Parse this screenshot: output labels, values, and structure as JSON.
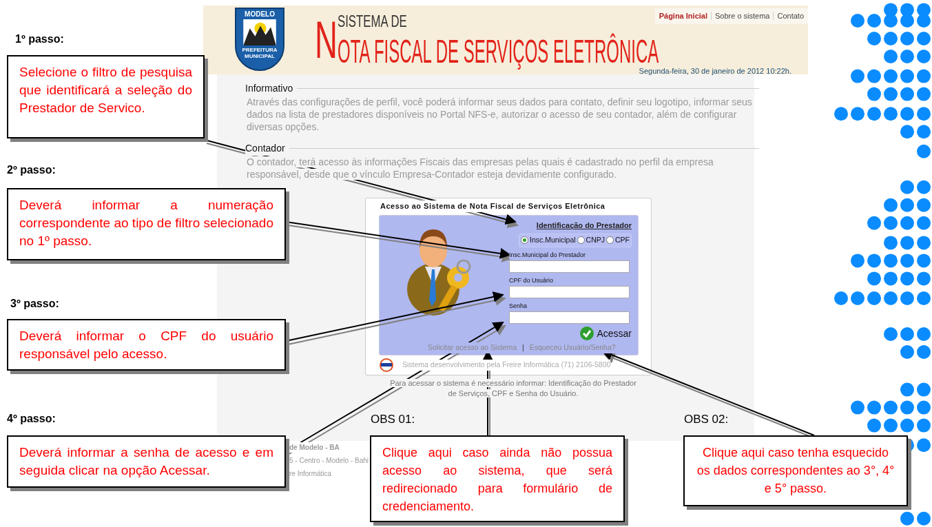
{
  "steps": [
    {
      "heading": "1º passo:",
      "text": "Selecione o filtro de pesquisa que identificará a seleção do Prestador de Servico."
    },
    {
      "heading": "2º passo:",
      "text": "Deverá informar a numeração correspondente ao tipo de filtro selecionado no 1º passo."
    },
    {
      "heading": "3º passo:",
      "text": "Deverá informar o CPF do usuário responsável pelo acesso."
    },
    {
      "heading": "4º passo:",
      "text": "Deverá informar a senha de acesso e em seguida clicar na opção Acessar."
    }
  ],
  "notes": [
    {
      "heading": "OBS 01:",
      "text": "Clique aqui caso ainda não possua acesso ao sistema, que será redirecionado para formulário de credenciamento."
    },
    {
      "heading": "OBS 02:",
      "text": "Clique aqui caso tenha esquecido os dados correspondentes ao 3°, 4° e 5° passo."
    }
  ],
  "header": {
    "logo_top": "MODELO",
    "logo_band": "PREFEITURA MUNICIPAL",
    "title_small": "SISTEMA DE",
    "title_initial": "N",
    "title_rest": "OTA FISCAL DE SERVIÇOS ELETRÔNICA",
    "nav": [
      {
        "label": "Página Inicial",
        "selected": true
      },
      {
        "label": "Sobre o sistema",
        "selected": false
      },
      {
        "label": "Contato",
        "selected": false
      }
    ],
    "date": "Segunda-feira, 30 de janeiro de 2012 10:22h."
  },
  "sections": [
    {
      "title": "Informativo",
      "text": "Através das configurações de perfil, você poderá informar seus dados para contato, definir seu logotipo, informar seus dados na lista de prestadores disponíveis no Portal NFS-e, autorizar o acesso de seu contador, além de configurar diversas opções."
    },
    {
      "title": "Contador",
      "text": "O contador, terá acesso às informações Fiscais das empresas pelas quais é cadastrado no perfil da empresa responsável, desde que o vínculo Empresa-Contador esteja devidamente configurado."
    }
  ],
  "login": {
    "title": "Acesso ao Sistema de Nota Fiscal de Serviços Eletrônica",
    "group_title": "Identificação do Prestador",
    "radios": [
      {
        "label": "Insc.Municipal",
        "selected": true
      },
      {
        "label": "CNPJ",
        "selected": false
      },
      {
        "label": "CPF",
        "selected": false
      }
    ],
    "fields": [
      {
        "label": "Insc.Municipal do Prestador"
      },
      {
        "label": "CPF do Usuário"
      },
      {
        "label": "Senha"
      }
    ],
    "submit": "Acessar",
    "links": [
      "Solicitar acesso ao Sistema",
      "Esqueceu Usuário/Senha?"
    ],
    "separator": "|",
    "developer": "Sistema desenvolvimento pela Freire Informática (71) 2106-5800",
    "help": "Para acessar o sistema é necessário informar: Identificação do Prestador de Serviços, CPF e Senha do Usuário."
  },
  "footer": [
    "de Modelo - BA",
    "5 - Centro - Modelo - Bahi",
    "re Informática"
  ]
}
